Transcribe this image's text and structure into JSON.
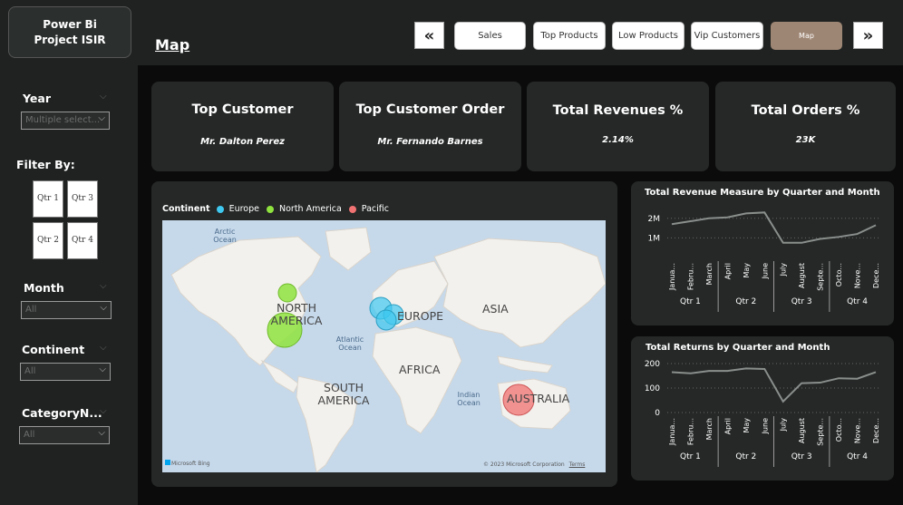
{
  "sidebar": {
    "project_title": "Power Bi Project ISIR",
    "year": {
      "label": "Year",
      "value": "Multiple select..."
    },
    "filter_by": {
      "label": "Filter By:",
      "quarters": [
        "Qtr 1",
        "Qtr 3",
        "Qtr 2",
        "Qtr 4"
      ]
    },
    "month": {
      "label": "Month",
      "value": "All"
    },
    "continent": {
      "label": "Continent",
      "value": "All"
    },
    "category": {
      "label": "CategoryN...",
      "value": "All"
    }
  },
  "header": {
    "page_title": "Map",
    "nav": {
      "prev": "«",
      "next": "»",
      "buttons": [
        "Sales",
        "Top Products",
        "Low Products",
        "Vip Customers",
        "Map"
      ],
      "active": "Map"
    }
  },
  "kpis": [
    {
      "title": "Top Customer",
      "value": "Mr. Dalton Perez"
    },
    {
      "title": "Top Customer Order",
      "value": "Mr. Fernando Barnes"
    },
    {
      "title": "Total Revenues %",
      "value": "2.14%"
    },
    {
      "title": "Total Orders %",
      "value": "23K"
    }
  ],
  "map": {
    "legend_title": "Continent",
    "legend": [
      {
        "name": "Europe",
        "color": "#3fc8f0"
      },
      {
        "name": "North America",
        "color": "#8fe33e"
      },
      {
        "name": "Pacific",
        "color": "#f07272"
      }
    ],
    "labels": {
      "arctic": "Arctic Ocean",
      "north_america": "NORTH AMERICA",
      "europe": "EUROPE",
      "asia": "ASIA",
      "atlantic": "Atlantic Ocean",
      "africa": "AFRICA",
      "south_america": "SOUTH AMERICA",
      "indian": "Indian Ocean",
      "australia": "AUSTRALIA"
    },
    "attribution": "Microsoft Bing",
    "copyright": "© 2023 Microsoft Corporation",
    "terms": "Terms"
  },
  "charts": {
    "revenue": {
      "title": "Total Revenue Measure by Quarter and Month",
      "y_ticks": [
        "2M",
        "1M"
      ]
    },
    "returns": {
      "title": "Total Returns by Quarter and Month",
      "y_ticks": [
        "200",
        "100",
        "0"
      ]
    }
  },
  "chart_data": [
    {
      "type": "line",
      "title": "Total Revenue Measure by Quarter and Month",
      "x": [
        "Janua...",
        "Febru...",
        "March",
        "April",
        "May",
        "June",
        "July",
        "August",
        "Septe...",
        "Octo...",
        "Nove...",
        "Dece..."
      ],
      "quarters": [
        "Qtr 1",
        "Qtr 2",
        "Qtr 3",
        "Qtr 4"
      ],
      "values": [
        1700000,
        1850000,
        2000000,
        2050000,
        2250000,
        2300000,
        750000,
        750000,
        950000,
        1050000,
        1200000,
        1650000
      ],
      "ylim": [
        0,
        2500000
      ],
      "color": "#8a8f8c"
    },
    {
      "type": "line",
      "title": "Total Returns by Quarter and Month",
      "x": [
        "Janua...",
        "Febru...",
        "March",
        "April",
        "May",
        "June",
        "July",
        "August",
        "Septe...",
        "Octo...",
        "Nove...",
        "Dece..."
      ],
      "quarters": [
        "Qtr 1",
        "Qtr 2",
        "Qtr 3",
        "Qtr 4"
      ],
      "values": [
        165,
        160,
        170,
        170,
        180,
        178,
        45,
        120,
        122,
        140,
        138,
        165
      ],
      "ylim": [
        0,
        200
      ],
      "color": "#8a8f8c"
    }
  ]
}
